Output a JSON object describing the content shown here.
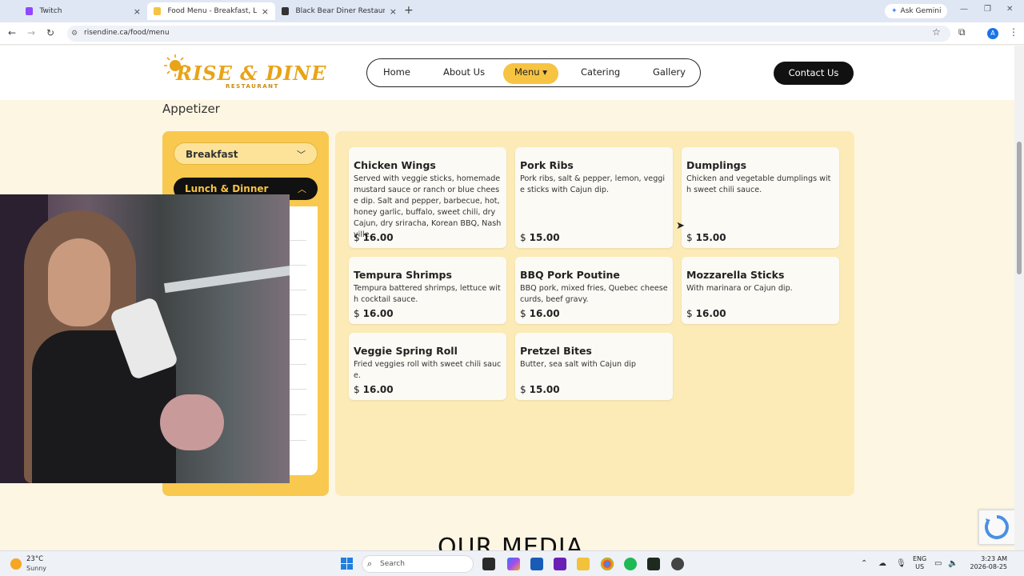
{
  "browser": {
    "tabs": [
      {
        "label": "Twitch",
        "color": "#9146ff",
        "active": false
      },
      {
        "label": "Food Menu - Breakfast, Lunch & Dinner",
        "color": "#f6c343",
        "active": true
      },
      {
        "label": "Black Bear Diner Restaurant Menu",
        "color": "#333333",
        "active": false
      }
    ],
    "new_tab": "+",
    "ask_gemini": "Ask Gemini",
    "url": "risendine.ca/food/menu"
  },
  "site": {
    "logo_main": "RISE & DINE",
    "logo_sub": "RESTAURANT",
    "nav": [
      "Home",
      "About Us",
      "Menu",
      "Catering",
      "Gallery"
    ],
    "nav_active": "Menu",
    "contact_button": "Contact Us",
    "section_title": "Appetizer",
    "sidebar": {
      "breakfast": "Breakfast",
      "lunch_dinner": "Lunch & Dinner"
    },
    "media_title": "OUR MEDIA"
  },
  "menu_items": [
    {
      "name": "Chicken Wings",
      "description": "Served with veggie sticks, homemade mustard sauce or ranch or blue cheese dip. Salt and pepper, barbecue, hot, honey garlic, buffalo, sweet chili, dry Cajun, dry sriracha, Korean BBQ, Nashville.",
      "currency": "$",
      "price": "16.00"
    },
    {
      "name": "Pork Ribs",
      "description": "Pork ribs, salt & pepper, lemon, veggie sticks with Cajun dip.",
      "currency": "$",
      "price": "15.00"
    },
    {
      "name": "Dumplings",
      "description": "Chicken and vegetable dumplings with sweet chili sauce.",
      "currency": "$",
      "price": "15.00"
    },
    {
      "name": "Tempura Shrimps",
      "description": "Tempura battered shrimps, lettuce with cocktail sauce.",
      "currency": "$",
      "price": "16.00"
    },
    {
      "name": "BBQ Pork Poutine",
      "description": "BBQ pork, mixed fries, Quebec cheese curds, beef gravy.",
      "currency": "$",
      "price": "16.00"
    },
    {
      "name": "Mozzarella Sticks",
      "description": "With marinara or Cajun dip.",
      "currency": "$",
      "price": "16.00"
    },
    {
      "name": "Veggie Spring Roll",
      "description": "Fried veggies roll with sweet chili sauce.",
      "currency": "$",
      "price": "16.00"
    },
    {
      "name": "Pretzel Bites",
      "description": "Butter, sea salt with Cajun dip",
      "currency": "$",
      "price": "15.00"
    }
  ],
  "taskbar": {
    "temperature": "23°C",
    "weather": "Sunny",
    "search": "Search",
    "lang_top": "ENG",
    "lang_bottom": "US",
    "time": "3:23 AM",
    "date": "2026-08-25"
  },
  "colors": {
    "accent": "#f6c343",
    "panel": "#fcebb7",
    "dark": "#111111"
  }
}
